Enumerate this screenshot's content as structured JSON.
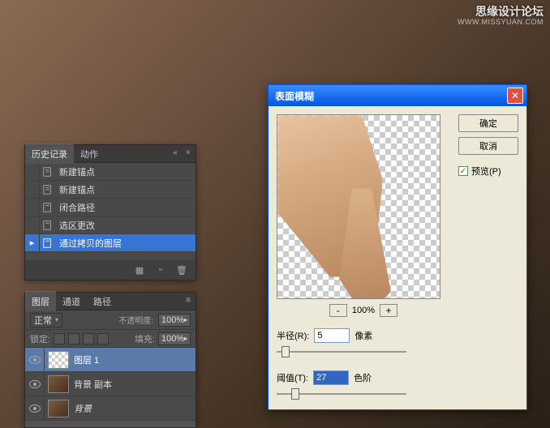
{
  "watermark": {
    "text": "思缘设计论坛",
    "url": "WWW.MISSYUAN.COM"
  },
  "history_panel": {
    "tabs": [
      {
        "label": "历史记录",
        "active": true
      },
      {
        "label": "动作",
        "active": false
      }
    ],
    "items": [
      {
        "label": "新建锚点",
        "selected": false
      },
      {
        "label": "新建锚点",
        "selected": false
      },
      {
        "label": "闭合路径",
        "selected": false
      },
      {
        "label": "选区更改",
        "selected": false
      },
      {
        "label": "通过拷贝的图层",
        "selected": true
      }
    ]
  },
  "layers_panel": {
    "tabs": [
      {
        "label": "图层",
        "active": true
      },
      {
        "label": "通道",
        "active": false
      },
      {
        "label": "路径",
        "active": false
      }
    ],
    "blend_mode": "正常",
    "opacity_label": "不透明度:",
    "opacity_value": "100%",
    "lock_label": "锁定:",
    "fill_label": "填充:",
    "fill_value": "100%",
    "layers": [
      {
        "name": "图层 1",
        "selected": true,
        "thumb": "checker"
      },
      {
        "name": "背景 副本",
        "selected": false,
        "thumb": "bg"
      },
      {
        "name": "背景",
        "selected": false,
        "thumb": "bg",
        "italic": true
      }
    ]
  },
  "dialog": {
    "title": "表面模糊",
    "ok": "确定",
    "cancel": "取消",
    "preview_chk": "预览(P)",
    "zoom": "100%",
    "radius_label": "半径(R):",
    "radius_value": "5",
    "radius_unit": "像素",
    "threshold_label": "阈值(T):",
    "threshold_value": "27",
    "threshold_unit": "色阶"
  }
}
